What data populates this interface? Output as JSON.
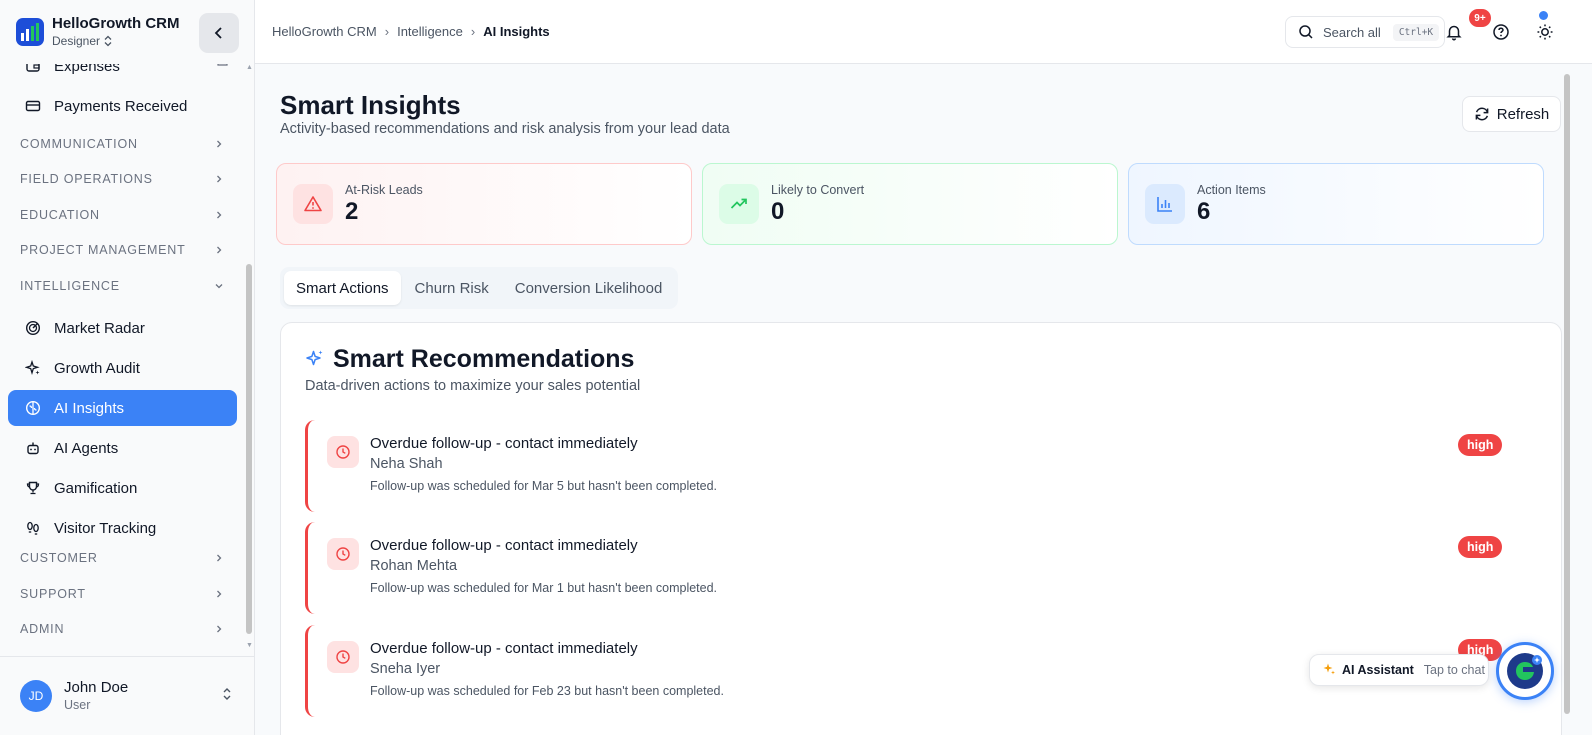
{
  "brand": {
    "name": "HelloGrowth CRM",
    "role": "Designer"
  },
  "sidebar": {
    "items_top": [
      {
        "label": "Expenses",
        "icon": "wallet-icon"
      },
      {
        "label": "Payments Received",
        "icon": "credit-card-icon"
      }
    ],
    "sections": [
      "COMMUNICATION",
      "FIELD OPERATIONS",
      "EDUCATION",
      "PROJECT MANAGEMENT",
      "INTELLIGENCE"
    ],
    "intelligence_items": [
      {
        "label": "Market Radar",
        "icon": "radar-icon"
      },
      {
        "label": "Growth Audit",
        "icon": "sparkles-icon"
      },
      {
        "label": "AI Insights",
        "icon": "brain-icon"
      },
      {
        "label": "AI Agents",
        "icon": "bot-icon"
      },
      {
        "label": "Gamification",
        "icon": "trophy-icon"
      },
      {
        "label": "Visitor Tracking",
        "icon": "footprints-icon"
      }
    ],
    "sections_bottom": [
      "CUSTOMER",
      "SUPPORT",
      "ADMIN"
    ],
    "user": {
      "initials": "JD",
      "name": "John Doe",
      "role": "User"
    }
  },
  "topbar": {
    "breadcrumb": [
      "HelloGrowth CRM",
      "Intelligence",
      "AI Insights"
    ],
    "search_label": "Search all",
    "search_shortcut": "Ctrl+K",
    "notifications_badge": "9+"
  },
  "page": {
    "title": "Smart Insights",
    "subtitle": "Activity-based recommendations and risk analysis from your lead data",
    "refresh_label": "Refresh"
  },
  "stats": [
    {
      "label": "At-Risk Leads",
      "value": "2",
      "icon": "alert-triangle-icon",
      "color": "#ef4444"
    },
    {
      "label": "Likely to Convert",
      "value": "0",
      "icon": "trending-up-icon",
      "color": "#22c55e"
    },
    {
      "label": "Action Items",
      "value": "6",
      "icon": "bar-chart-icon",
      "color": "#3b82f6"
    }
  ],
  "tabs": [
    "Smart Actions",
    "Churn Risk",
    "Conversion Likelihood"
  ],
  "recommendations": {
    "title": "Smart Recommendations",
    "subtitle": "Data-driven actions to maximize your sales potential",
    "items": [
      {
        "title": "Overdue follow-up - contact immediately",
        "name": "Neha Shah",
        "description": "Follow-up was scheduled for Mar 5 but hasn't been completed.",
        "priority": "high"
      },
      {
        "title": "Overdue follow-up - contact immediately",
        "name": "Rohan Mehta",
        "description": "Follow-up was scheduled for Mar 1 but hasn't been completed.",
        "priority": "high"
      },
      {
        "title": "Overdue follow-up - contact immediately",
        "name": "Sneha Iyer",
        "description": "Follow-up was scheduled for Feb 23 but hasn't been completed.",
        "priority": "high"
      }
    ]
  },
  "assistant": {
    "name": "AI Assistant",
    "hint": "Tap to chat"
  },
  "colors": {
    "accent": "#3b82f6",
    "danger": "#ef4444",
    "success": "#22c55e"
  }
}
